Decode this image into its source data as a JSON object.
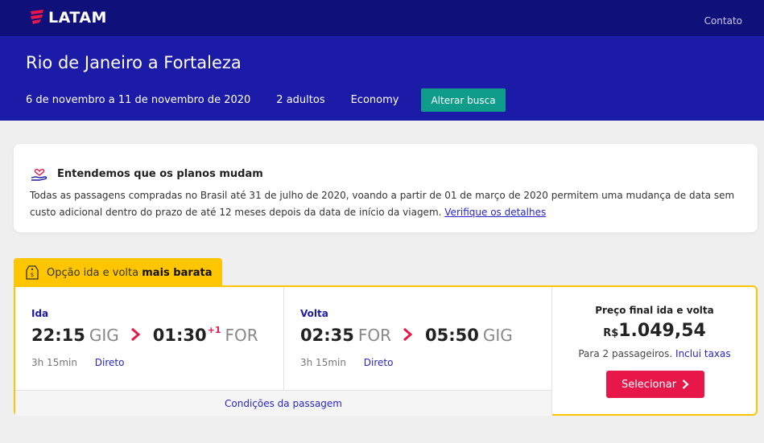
{
  "header": {
    "logo_text": "LATAM",
    "contato_label": "Contato",
    "route_title": "Rio de Janeiro a Fortaleza",
    "dates": "6 de novembro a 11 de novembro de 2020",
    "passengers": "2 adultos",
    "cabin": "Economy",
    "alter_button": "Alterar busca"
  },
  "notice": {
    "icon": "heart-hand-icon",
    "title": "Entendemos que os planos mudam",
    "body": "Todas as passagens compradas no Brasil até 31 de julho de 2020, voando a partir de 01 de março de 2020 permitem uma mudança de data sem custo adicional dentro do prazo de até 12 meses depois da data de início da viagem.",
    "link": "Verifique os detalhes"
  },
  "tag": {
    "icon": "price-tag-icon",
    "text": "Opção ida e volta",
    "bold": "mais barata"
  },
  "flights": {
    "ida": {
      "label": "Ida",
      "dep_time": "22:15",
      "dep_code": "GIG",
      "arr_time": "01:30",
      "arr_day": "+1",
      "arr_code": "FOR",
      "duration": "3h 15min",
      "type": "Direto"
    },
    "volta": {
      "label": "Volta",
      "dep_time": "02:35",
      "dep_code": "FOR",
      "arr_time": "05:50",
      "arr_day": "",
      "arr_code": "GIG",
      "duration": "3h 15min",
      "type": "Direto"
    },
    "conditions_link": "Condições da passagem"
  },
  "price": {
    "label": "Preço final ida e volta",
    "currency": "R$",
    "amount": "1.049,54",
    "passengers_text": "Para 2 passageiros.",
    "taxes_link": "Inclui taxas",
    "select_button": "Selecionar"
  },
  "colors": {
    "header_bg": "#1c1ba8",
    "top_strip": "#10107a",
    "accent_teal": "#0f9c8a",
    "accent_red": "#e8174a",
    "highlight_yellow": "#ffc600",
    "link_blue": "#2a25c8"
  }
}
